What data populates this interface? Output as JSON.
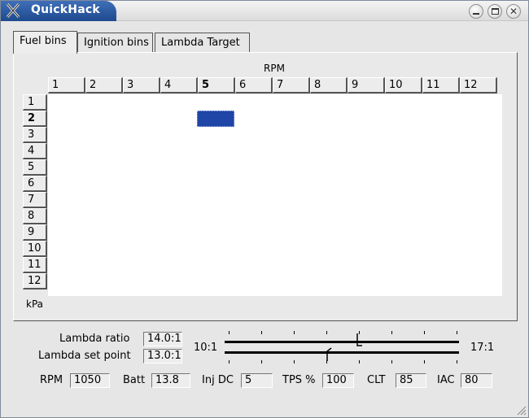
{
  "window": {
    "title": "QuickHack",
    "controls": [
      "minimize",
      "maximize",
      "close"
    ]
  },
  "tabs": [
    {
      "label": "Fuel bins",
      "active": true
    },
    {
      "label": "Ignition bins",
      "active": false
    },
    {
      "label": "Lambda Target",
      "active": false
    }
  ],
  "table": {
    "column_axis_label": "RPM",
    "row_axis_label": "kPa",
    "columns": [
      "1",
      "2",
      "3",
      "4",
      "5",
      "6",
      "7",
      "8",
      "9",
      "10",
      "11",
      "12"
    ],
    "rows": [
      "1",
      "2",
      "3",
      "4",
      "5",
      "6",
      "7",
      "8",
      "9",
      "10",
      "11",
      "12"
    ],
    "selected_column": "5",
    "selected_row": "2",
    "selection_color": "#1f46a6"
  },
  "lambda": {
    "ratio_label": "Lambda ratio",
    "ratio_value": "14.0:1",
    "setpoint_label": "Lambda set point",
    "setpoint_value": "13.0:1",
    "scale_min": "10:1",
    "scale_max": "17:1"
  },
  "status": {
    "rpm_label": "RPM",
    "rpm_value": "1050",
    "batt_label": "Batt",
    "batt_value": "13.8",
    "injdc_label": "Inj DC",
    "injdc_value": "5",
    "tps_label": "TPS %",
    "tps_value": "100",
    "clt_label": "CLT",
    "clt_value": "85",
    "iac_label": "IAC",
    "iac_value": "80"
  },
  "colors": {
    "title_bar": "#2a5aa3",
    "selected_cell": "#1f46a6",
    "window_bg": "#e6e6e6"
  }
}
